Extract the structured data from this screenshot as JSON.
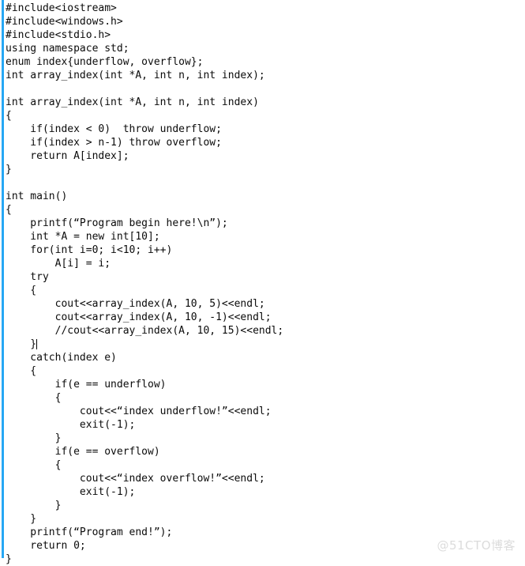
{
  "document": {
    "kind": "code-screenshot",
    "language": "C++",
    "background_color": "#ffffff",
    "text_color": "#0b0b0b",
    "gutter_bar_color": "#26a7f4",
    "watermark_color": "#dcdcdc"
  },
  "watermark": {
    "text": "@51CTO博客"
  },
  "caret": {
    "visible": true,
    "line_index": 25,
    "after_character": "{"
  },
  "code": {
    "lines": [
      "#include<iostream>",
      "#include<windows.h>",
      "#include<stdio.h>",
      "using namespace std;",
      "enum index{underflow, overflow};",
      "int array_index(int *A, int n, int index);",
      "",
      "int array_index(int *A, int n, int index)",
      "{",
      "    if(index < 0)  throw underflow;",
      "    if(index > n-1) throw overflow;",
      "    return A[index];",
      "}",
      "",
      "int main()",
      "{",
      "    printf(“Program begin here!\\n”);",
      "    int *A = new int[10];",
      "    for(int i=0; i<10; i++)",
      "        A[i] = i;",
      "    try",
      "    {",
      "        cout<<array_index(A, 10, 5)<<endl;",
      "        cout<<array_index(A, 10, -1)<<endl;",
      "        //cout<<array_index(A, 10, 15)<<endl;",
      "    }",
      "    catch(index e)",
      "    {",
      "        if(e == underflow)",
      "        {",
      "            cout<<“index underflow!”<<endl;",
      "            exit(-1);",
      "        }",
      "        if(e == overflow)",
      "        {",
      "            cout<<“index overflow!”<<endl;",
      "            exit(-1);",
      "        }",
      "    }",
      "    printf(“Program end!”);",
      "    return 0;",
      "}"
    ]
  }
}
